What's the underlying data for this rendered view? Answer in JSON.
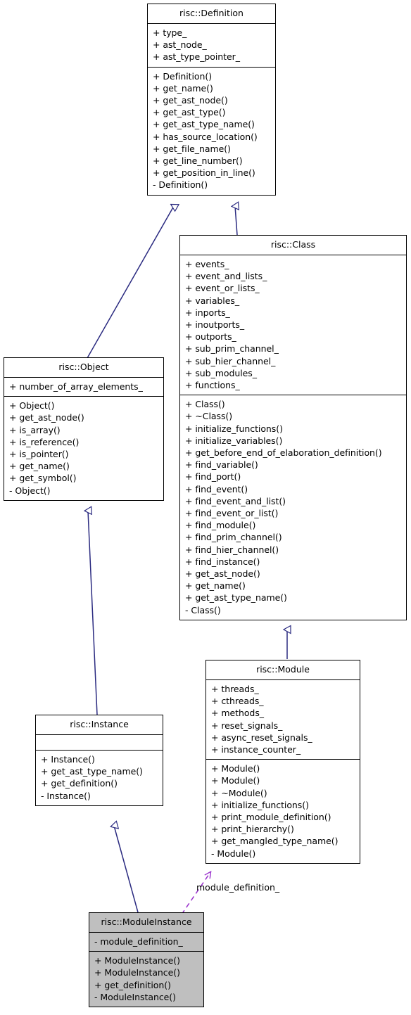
{
  "diagram": {
    "title": "risc::ModuleInstance class inheritance diagram",
    "colors": {
      "inheritance_edge": "#2a2a80",
      "association_edge": "#9a32cd",
      "node_border": "#000000",
      "node_fill": "#ffffff",
      "highlight_fill": "#bfbfbf",
      "text": "#000000"
    }
  },
  "nodes": {
    "definition": {
      "title": "risc::Definition",
      "attributes": [
        "+ type_",
        "+ ast_node_",
        "+ ast_type_pointer_"
      ],
      "methods": [
        "+ Definition()",
        "+ get_name()",
        "+ get_ast_node()",
        "+ get_ast_type()",
        "+ get_ast_type_name()",
        "+ has_source_location()",
        "+ get_file_name()",
        "+ get_line_number()",
        "+ get_position_in_line()",
        "- Definition()"
      ]
    },
    "klass": {
      "title": "risc::Class",
      "attributes": [
        "+ events_",
        "+ event_and_lists_",
        "+ event_or_lists_",
        "+ variables_",
        "+ inports_",
        "+ inoutports_",
        "+ outports_",
        "+ sub_prim_channel_",
        "+ sub_hier_channel_",
        "+ sub_modules_",
        "+ functions_"
      ],
      "methods": [
        "+ Class()",
        "+ ~Class()",
        "+ initialize_functions()",
        "+ initialize_variables()",
        "+ get_before_end_of_elaboration_definition()",
        "+ find_variable()",
        "+ find_port()",
        "+ find_event()",
        "+ find_event_and_list()",
        "+ find_event_or_list()",
        "+ find_module()",
        "+ find_prim_channel()",
        "+ find_hier_channel()",
        "+ find_instance()",
        "+ get_ast_node()",
        "+ get_name()",
        "+ get_ast_type_name()",
        "- Class()"
      ]
    },
    "object": {
      "title": "risc::Object",
      "attributes": [
        "+ number_of_array_elements_"
      ],
      "methods": [
        "+ Object()",
        "+ get_ast_node()",
        "+ is_array()",
        "+ is_reference()",
        "+ is_pointer()",
        "+ get_name()",
        "+ get_symbol()",
        "- Object()"
      ]
    },
    "module": {
      "title": "risc::Module",
      "attributes": [
        "+ threads_",
        "+ cthreads_",
        "+ methods_",
        "+ reset_signals_",
        "+ async_reset_signals_",
        "+ instance_counter_"
      ],
      "methods": [
        "+ Module()",
        "+ Module()",
        "+ ~Module()",
        "+ initialize_functions()",
        "+ print_module_definition()",
        "+ print_hierarchy()",
        "+ get_mangled_type_name()",
        "- Module()"
      ]
    },
    "instance": {
      "title": "risc::Instance",
      "attributes": [],
      "methods": [
        "+ Instance()",
        "+ get_ast_type_name()",
        "+ get_definition()",
        "- Instance()"
      ]
    },
    "module_instance": {
      "title": "risc::ModuleInstance",
      "attributes": [
        "- module_definition_"
      ],
      "methods": [
        "+ ModuleInstance()",
        "+ ModuleInstance()",
        "+ get_definition()",
        "- ModuleInstance()"
      ]
    }
  },
  "edges": {
    "module_definition_label": "module_definition_"
  }
}
